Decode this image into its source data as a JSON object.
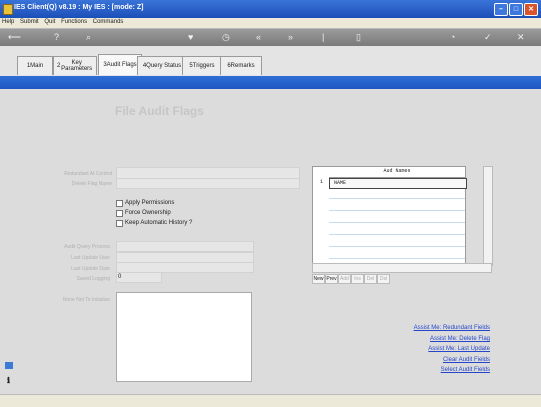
{
  "window": {
    "title": "IES Client(Q) v8.19 : My IES :      [mode: Z]",
    "min": "–",
    "max": "□",
    "close": "✕"
  },
  "menu": [
    "Help",
    "Submit",
    "Quit",
    "Functions",
    "Commands"
  ],
  "toolbar": {
    "icons": [
      "arrow-icon",
      "help-icon",
      "search-icon",
      "heart-icon",
      "clock-icon",
      "back-icon",
      "forward-icon",
      "pipe-icon",
      "pipe-icon",
      "lock-icon",
      "check-icon",
      "close-icon"
    ]
  },
  "tabs": [
    {
      "num": "1",
      "label": "Main"
    },
    {
      "num": "2",
      "label": "Key Parameters"
    },
    {
      "num": "3",
      "label": "Audit Flags"
    },
    {
      "num": "4",
      "label": "Query Status"
    },
    {
      "num": "5",
      "label": "Triggers"
    },
    {
      "num": "6",
      "label": "Remarks"
    }
  ],
  "form": {
    "heading": "File Audit Flags",
    "labels": {
      "redundant": "Redundant At Control",
      "delete_flag": "Delete Flag Name",
      "audit_query": "Audit Query Process",
      "last_user": "Last Update User",
      "last_date": "Last Update Date",
      "saved_logging": "Saved Logging",
      "none": "None Not To Initialize"
    },
    "saved_logging_value": "0",
    "checkboxes": [
      "Apply Permissions",
      "Force Ownership",
      "Keep Automatic History ?"
    ]
  },
  "grid": {
    "header": "Aud Names",
    "rows": [
      {
        "num": "1",
        "value": "NAME"
      }
    ],
    "nav": [
      "New",
      "Prev",
      "Add",
      "Ins",
      "Del",
      "Dsl"
    ]
  },
  "assist": [
    "Assist Me: Redundant Fields",
    "Assist Me: Delete Flag",
    "Assist Me: Last Update",
    "Clear Audit Fields",
    "Select Audit Fields"
  ]
}
